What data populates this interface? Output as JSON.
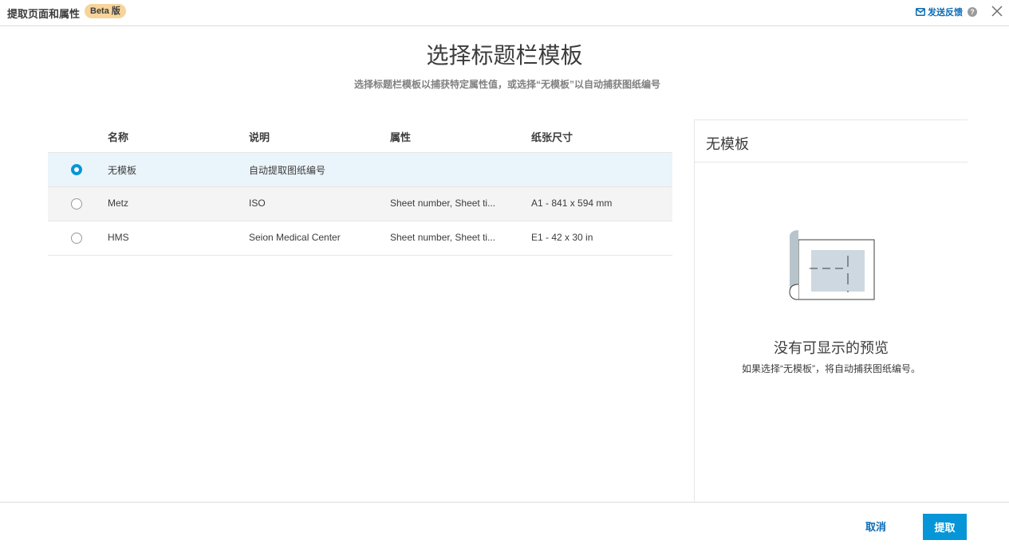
{
  "header": {
    "title": "提取页面和属性",
    "beta_badge": "Beta 版",
    "feedback_label": "发送反馈",
    "help_glyph": "?"
  },
  "main": {
    "heading": "选择标题栏模板",
    "subheading": "选择标题栏模板以捕获特定属性值，或选择“无模板”以自动捕获图纸编号"
  },
  "table": {
    "columns": [
      "名称",
      "说明",
      "属性",
      "纸张尺寸"
    ],
    "rows": [
      {
        "name": "无模板",
        "description": "自动提取图纸编号",
        "attributes": "",
        "paper_size": "",
        "selected": true
      },
      {
        "name": "Metz",
        "description": "ISO",
        "attributes": "Sheet number, Sheet ti...",
        "paper_size": "A1 - 841 x 594 mm",
        "selected": false
      },
      {
        "name": "HMS",
        "description": "Seion Medical Center",
        "attributes": "Sheet number, Sheet ti...",
        "paper_size": "E1 - 42 x 30 in",
        "selected": false
      }
    ]
  },
  "preview": {
    "title": "无模板",
    "empty_title": "没有可显示的预览",
    "empty_note": "如果选择“无模板”，将自动捕获图纸编号。"
  },
  "footer": {
    "cancel_label": "取消",
    "extract_label": "提取"
  },
  "colors": {
    "accent": "#0696d7",
    "link": "#0a6bb5",
    "beta_badge": "#f6d49a",
    "selected_row": "#eaf4fb"
  },
  "icons": {
    "feedback": "mail-icon",
    "help": "help-icon",
    "close": "close-icon",
    "preview": "sheet-placeholder-icon"
  }
}
